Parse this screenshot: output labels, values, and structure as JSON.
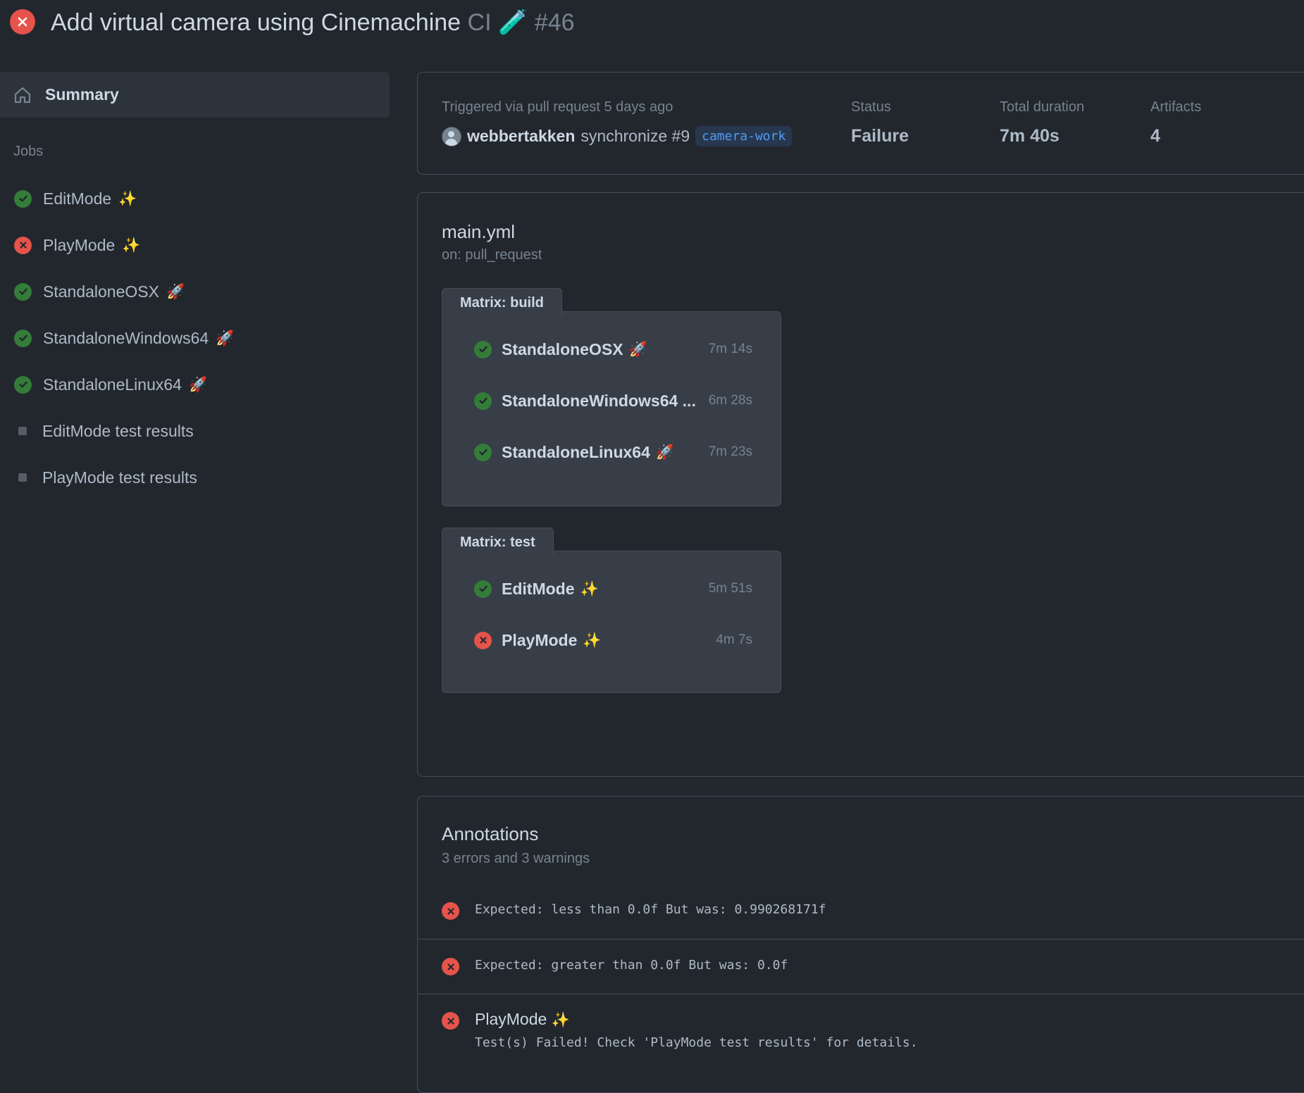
{
  "header": {
    "title": "Add virtual camera using Cinemachine",
    "workflow": "CI",
    "workflow_emoji": "🧪",
    "run_number": "#46"
  },
  "sidebar": {
    "summary_label": "Summary",
    "jobs_heading": "Jobs",
    "jobs": [
      {
        "label": "EditMode",
        "emoji": "✨",
        "status": "success"
      },
      {
        "label": "PlayMode",
        "emoji": "✨",
        "status": "failure"
      },
      {
        "label": "StandaloneOSX",
        "emoji": "🚀",
        "status": "success"
      },
      {
        "label": "StandaloneWindows64",
        "emoji": "🚀",
        "status": "success"
      },
      {
        "label": "StandaloneLinux64",
        "emoji": "🚀",
        "status": "success"
      },
      {
        "label": "EditMode test results",
        "emoji": "",
        "status": "pending"
      },
      {
        "label": "PlayMode test results",
        "emoji": "",
        "status": "pending"
      }
    ]
  },
  "run": {
    "trigger": "Triggered via pull request 5 days ago",
    "actor": "webbertakken",
    "action": "synchronize #9",
    "branch": "camera-work",
    "status_label": "Status",
    "status_value": "Failure",
    "duration_label": "Total duration",
    "duration_value": "7m 40s",
    "artifacts_label": "Artifacts",
    "artifacts_value": "4"
  },
  "workflow": {
    "file": "main.yml",
    "on": "on: pull_request",
    "matrices": [
      {
        "title": "Matrix: build",
        "jobs": [
          {
            "name": "StandaloneOSX",
            "emoji": "🚀",
            "duration": "7m 14s",
            "status": "success"
          },
          {
            "name": "StandaloneWindows64 ...",
            "emoji": "",
            "duration": "6m 28s",
            "status": "success"
          },
          {
            "name": "StandaloneLinux64",
            "emoji": "🚀",
            "duration": "7m 23s",
            "status": "success"
          }
        ]
      },
      {
        "title": "Matrix: test",
        "jobs": [
          {
            "name": "EditMode",
            "emoji": "✨",
            "duration": "5m 51s",
            "status": "success"
          },
          {
            "name": "PlayMode",
            "emoji": "✨",
            "duration": "4m 7s",
            "status": "failure"
          }
        ]
      }
    ]
  },
  "annotations": {
    "title": "Annotations",
    "subtitle": "3 errors and 3 warnings",
    "items": [
      {
        "message": "Expected: less than 0.0f But was: 0.990268171f"
      },
      {
        "message": "Expected: greater than 0.0f But was: 0.0f"
      },
      {
        "title": "PlayMode",
        "emoji": "✨",
        "message": "Test(s) Failed! Check 'PlayMode test results' for details."
      }
    ]
  },
  "colors": {
    "background": "#22272e",
    "success": "#347d39",
    "failure": "#e5534b",
    "branch_text": "#539bf5"
  }
}
